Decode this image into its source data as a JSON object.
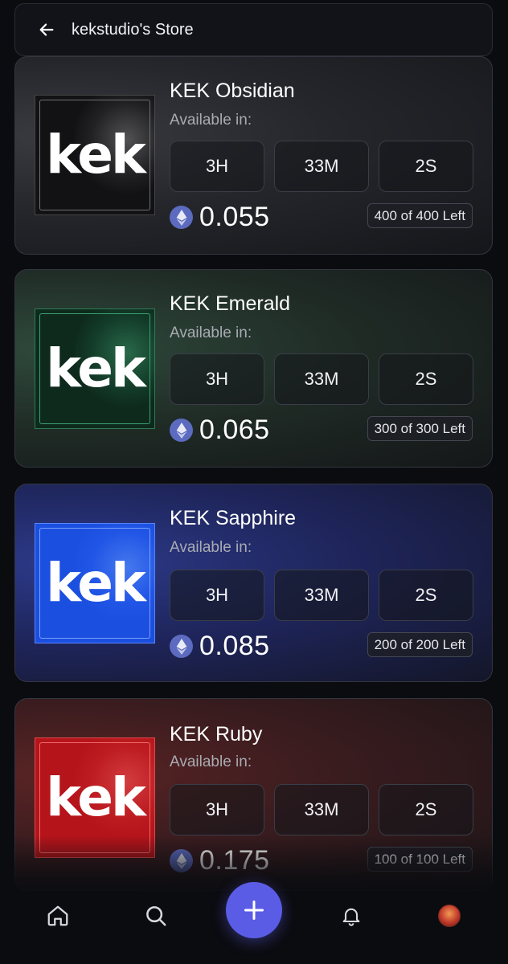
{
  "header": {
    "title": "kekstudio's Store"
  },
  "available_label": "Available in:",
  "products": [
    {
      "name": "KEK Obsidian",
      "logo": "kek",
      "timer": [
        "3H",
        "33M",
        "2S"
      ],
      "price": "0.055",
      "stock": "400 of 400 Left",
      "theme": "obsidian"
    },
    {
      "name": "KEK Emerald",
      "logo": "kek",
      "timer": [
        "3H",
        "33M",
        "2S"
      ],
      "price": "0.065",
      "stock": "300 of 300 Left",
      "theme": "emerald"
    },
    {
      "name": "KEK Sapphire",
      "logo": "kek",
      "timer": [
        "3H",
        "33M",
        "2S"
      ],
      "price": "0.085",
      "stock": "200 of 200 Left",
      "theme": "sapphire"
    },
    {
      "name": "KEK Ruby",
      "logo": "kek",
      "timer": [
        "3H",
        "33M",
        "2S"
      ],
      "price": "0.175",
      "stock": "100 of 100 Left",
      "theme": "ruby"
    }
  ],
  "nav": {
    "items": [
      "home-icon",
      "search-icon",
      "plus-icon",
      "bell-icon",
      "avatar"
    ],
    "accent": "#5b5ce6"
  },
  "colors": {
    "background": "#0b0c10",
    "obsidian": "#2a2b30",
    "emerald": "#1f6b45",
    "sapphire": "#1e5bff",
    "ruby": "#c4161c",
    "eth": "#5c6bc0"
  }
}
